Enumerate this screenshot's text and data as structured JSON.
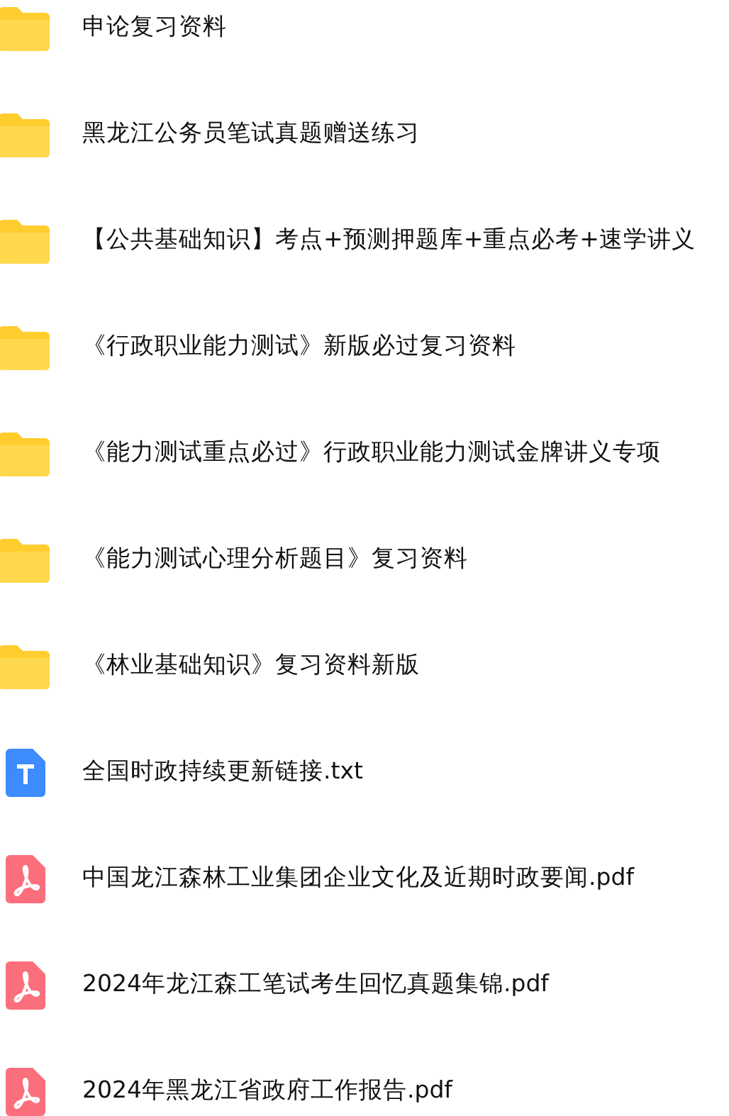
{
  "files": [
    {
      "kind": "folder",
      "name": "申论复习资料"
    },
    {
      "kind": "folder",
      "name": "黑龙江公务员笔试真题赠送练习"
    },
    {
      "kind": "folder",
      "name": "【公共基础知识】考点+预测押题库+重点必考+速学讲义"
    },
    {
      "kind": "folder",
      "name": "《行政职业能力测试》新版必过复习资料"
    },
    {
      "kind": "folder",
      "name": "《能力测试重点必过》行政职业能力测试金牌讲义专项"
    },
    {
      "kind": "folder",
      "name": "《能力测试心理分析题目》复习资料"
    },
    {
      "kind": "folder",
      "name": "《林业基础知识》复习资料新版"
    },
    {
      "kind": "txt",
      "name": "全国时政持续更新链接.txt"
    },
    {
      "kind": "pdf",
      "name": "中国龙江森林工业集团企业文化及近期时政要闻.pdf"
    },
    {
      "kind": "pdf",
      "name": "2024年龙江森工笔试考生回忆真题集锦.pdf"
    },
    {
      "kind": "pdf",
      "name": "2024年黑龙江省政府工作报告.pdf"
    }
  ]
}
